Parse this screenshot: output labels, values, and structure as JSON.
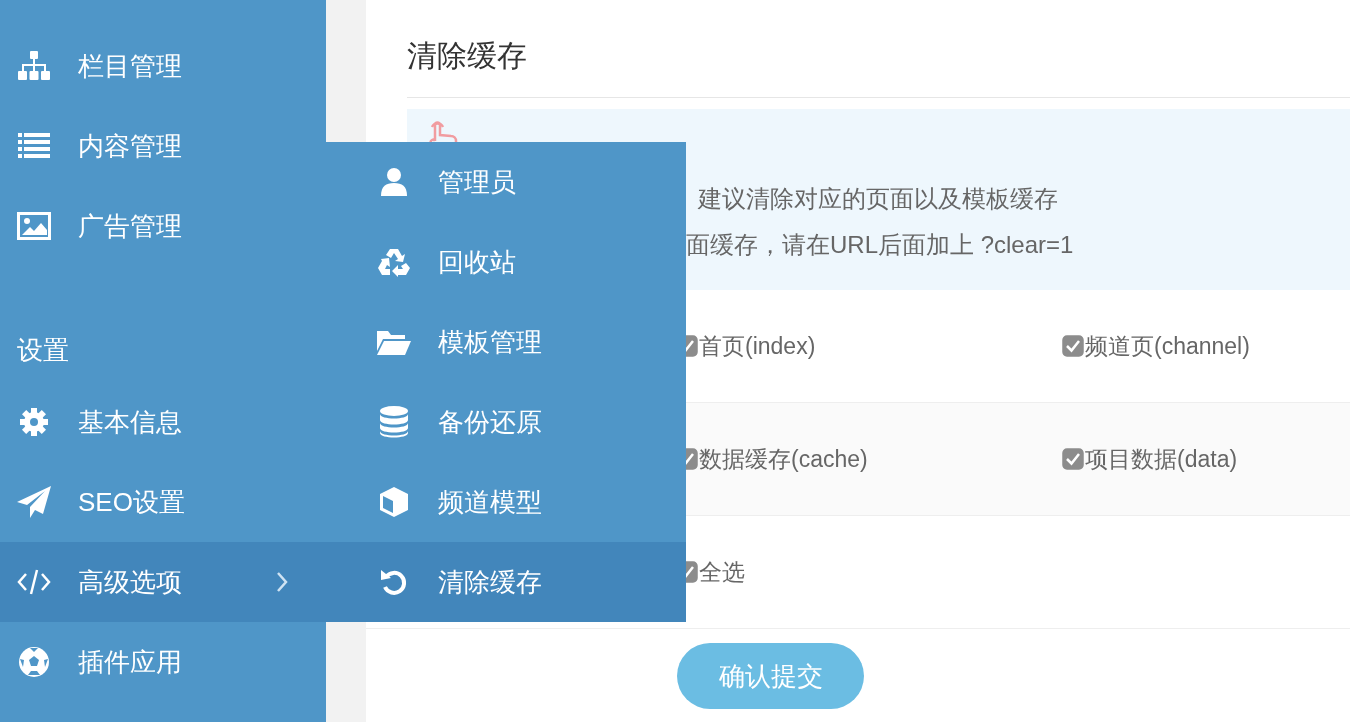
{
  "sidebar": {
    "items": [
      {
        "label": "栏目管理",
        "selected": false,
        "has_submenu": false
      },
      {
        "label": "内容管理",
        "selected": false,
        "has_submenu": false
      },
      {
        "label": "广告管理",
        "selected": false,
        "has_submenu": false
      }
    ],
    "sections": [
      {
        "title": "设置",
        "items": [
          {
            "label": "基本信息",
            "selected": false,
            "has_submenu": false
          },
          {
            "label": "SEO设置",
            "selected": false,
            "has_submenu": false
          },
          {
            "label": "高级选项",
            "selected": true,
            "has_submenu": true
          },
          {
            "label": "插件应用",
            "selected": false,
            "has_submenu": false
          }
        ]
      }
    ]
  },
  "submenu": {
    "items": [
      {
        "label": "管理员",
        "selected": false
      },
      {
        "label": "回收站",
        "selected": false
      },
      {
        "label": "模板管理",
        "selected": false
      },
      {
        "label": "备份还原",
        "selected": false
      },
      {
        "label": "频道模型",
        "selected": false
      },
      {
        "label": "清除缓存",
        "selected": true
      }
    ]
  },
  "panel": {
    "title": "清除缓存",
    "notice": {
      "lines": [
        "建议清除对应的页面以及模板缓存",
        "面缓存，请在URL后面加上 ?clear=1"
      ]
    },
    "options": [
      [
        {
          "label": "首页(index)",
          "checked": true
        },
        {
          "label": "频道页(channel)",
          "checked": true
        }
      ],
      [
        {
          "label": "数据缓存(cache)",
          "checked": true
        },
        {
          "label": "项目数据(data)",
          "checked": true
        }
      ],
      [
        {
          "label": "全选",
          "checked": true
        }
      ]
    ],
    "submit": "确认提交"
  }
}
